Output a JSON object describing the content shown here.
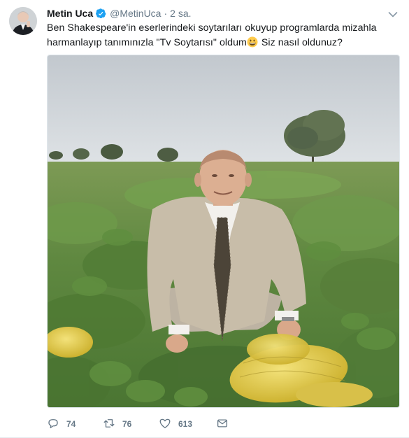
{
  "tweet": {
    "author_name": "Metin Uca",
    "handle": "@MetinUca",
    "separator": "·",
    "time": "2 sa.",
    "text_part1": "Ben Shakespeare'in eserlerindeki soytarıları okuyup programlarda mizahla harmanlayıp tanımınızla \"Tv Soytarısı\" oldum",
    "text_part2": " Siz nasıl oldunuz?",
    "emoji": "grinning-face",
    "verified": true
  },
  "actions": {
    "reply_count": "74",
    "retweet_count": "76",
    "like_count": "613"
  },
  "colors": {
    "verified": "#1da1f2",
    "secondary_text": "#657786",
    "primary_text": "#14171a"
  },
  "icons": [
    "verified-badge-icon",
    "chevron-down-icon",
    "reply-icon",
    "retweet-icon",
    "like-icon",
    "direct-message-icon"
  ]
}
